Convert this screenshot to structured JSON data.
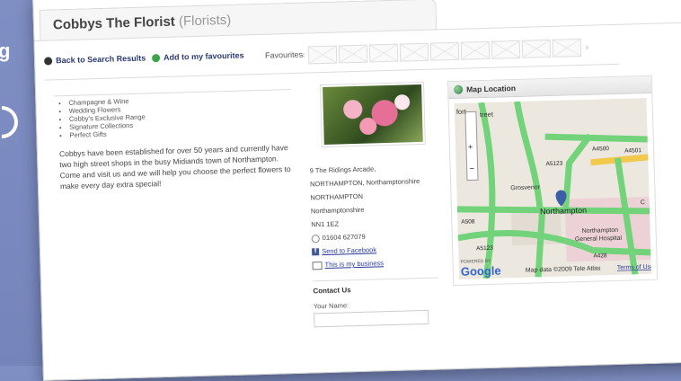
{
  "background": {
    "fragment_text": "g"
  },
  "business": {
    "name": "Cobbys The Florist",
    "category": "(Florists)"
  },
  "toolbar": {
    "back_label": "Back to Search Results",
    "add_fav_label": "Add to my favourites",
    "favourites_label": "Favourites",
    "fav_slots": 9
  },
  "features": [
    "Champagne & Wine",
    "Wedding Flowers",
    "Cobby's Exclusive Range",
    "Signature Collections",
    "Perfect Gifts"
  ],
  "description": "Cobbys have been established for over 50 years and currently have two high street shops in the busy Midiands town of Northampton. Come and visit us and we will help you choose the perfect flowers to make every day extra special!",
  "address": {
    "line1": "9 The Ridings Arcade,",
    "line2": "NORTHAMPTON, Northamptonshire",
    "line3": "NORTHAMPTON",
    "line4": "Northamptonshire",
    "postcode": "NN1 1EZ",
    "phone": "01604 627079"
  },
  "links": {
    "facebook": "Send to Facebook",
    "my_business": "This is my business"
  },
  "contact": {
    "heading": "Contact Us",
    "name_label": "Your Name:"
  },
  "map": {
    "heading": "Map Location",
    "labels": {
      "street_top": "fort",
      "street_top2": "treet",
      "area": "Grosvenor",
      "town": "Northampton",
      "hospital1": "Northampton",
      "hospital2": "General Hospital",
      "road_a4500": "A4500",
      "road_a4501": "A4501",
      "road_a5123a": "A5123",
      "road_a5123b": "A5123",
      "road_a428": "A428",
      "road_a508": "A508",
      "road_c": "C"
    },
    "attribution": "Map data ©2009 Tele Atlas",
    "terms": "Terms of Use",
    "brand": "Google",
    "powered": "POWERED BY",
    "controls": [
      "+",
      "−"
    ],
    "colors": {
      "road": "#72d37a",
      "major": "#f2c94c",
      "land": "#ece8df",
      "pink": "#ecd2d6",
      "pin": "#3b5ea8"
    }
  }
}
